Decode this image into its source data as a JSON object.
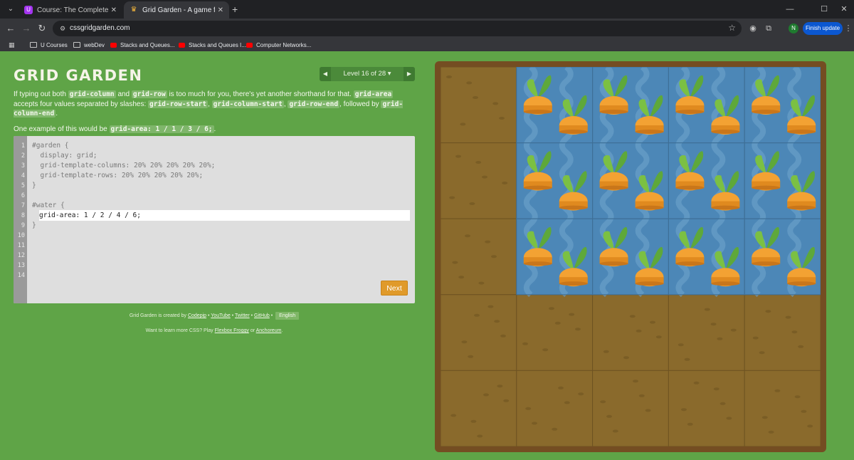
{
  "browser": {
    "tabs": [
      {
        "title": "Course: The Complete Full-Stac",
        "active": false,
        "icon": "udemy-icon"
      },
      {
        "title": "Grid Garden - A game for learni",
        "active": true,
        "icon": "garden-icon"
      }
    ],
    "url": "cssgridgarden.com",
    "finish_update": "Finish update",
    "profile_initial": "N",
    "bookmarks": [
      {
        "label": "U Courses",
        "icon": "folder-icon"
      },
      {
        "label": "webDev",
        "icon": "folder-icon"
      },
      {
        "label": "Stacks and Queues...",
        "icon": "youtube-icon"
      },
      {
        "label": "Stacks and Queues I...",
        "icon": "youtube-icon"
      },
      {
        "label": "Computer Networks...",
        "icon": "youtube-icon"
      }
    ]
  },
  "game": {
    "logo": "GRID GARDEN",
    "level_label": "Level 16 of 28",
    "level_caret": "▾",
    "instructions": {
      "p1_a": "If typing out both",
      "p1_kw1": "grid-column",
      "p1_b": "and",
      "p1_kw2": "grid-row",
      "p1_c": "is too much for you, there's yet another shorthand for that.",
      "p1_kw3": "grid-area",
      "p1_d": "accepts four values separated by slashes:",
      "p1_kw4": "grid-row-start",
      "p1_sep1": ",",
      "p1_kw5": "grid-column-start",
      "p1_sep2": ",",
      "p1_kw6": "grid-row-end",
      "p1_e": ", followed by",
      "p1_kw7": "grid-column-end",
      "p1_end": ".",
      "p2_a": "One example of this would be",
      "p2_kw": "grid-area: 1 / 1 / 3 / 6;",
      "p2_end": "."
    },
    "editor": {
      "line_numbers": [
        "1",
        "2",
        "3",
        "4",
        "5",
        "6",
        "7",
        "8",
        "9",
        "10",
        "11",
        "12",
        "13",
        "14"
      ],
      "lines": [
        "#garden {",
        "  display: grid;",
        "  grid-template-columns: 20% 20% 20% 20% 20%;",
        "  grid-template-rows: 20% 20% 20% 20% 20%;",
        "}",
        "",
        "#water {",
        "",
        "}"
      ],
      "input_value": "grid-area: 1 / 2 / 4 / 6;",
      "next_label": "Next"
    },
    "credits": {
      "prefix": "Grid Garden is created by",
      "codepip": "Codepip",
      "sep": "•",
      "youtube": "YouTube",
      "twitter": "Twitter",
      "github": "GitHub",
      "language": "English"
    },
    "more": {
      "prefix": "Want to learn more CSS? Play",
      "froggy": "Flexbox Froggy",
      "or": "or",
      "anchoreum": "Anchoreum",
      "end": "."
    }
  },
  "garden": {
    "rows": 5,
    "columns": 5,
    "water_area": "1 / 2 / 4 / 6",
    "colors": {
      "soil": "#8a6a2c",
      "water": "#4c87b7",
      "frame": "#744d22",
      "carrot": "#f3a233",
      "leaf": "#7bc043"
    }
  }
}
